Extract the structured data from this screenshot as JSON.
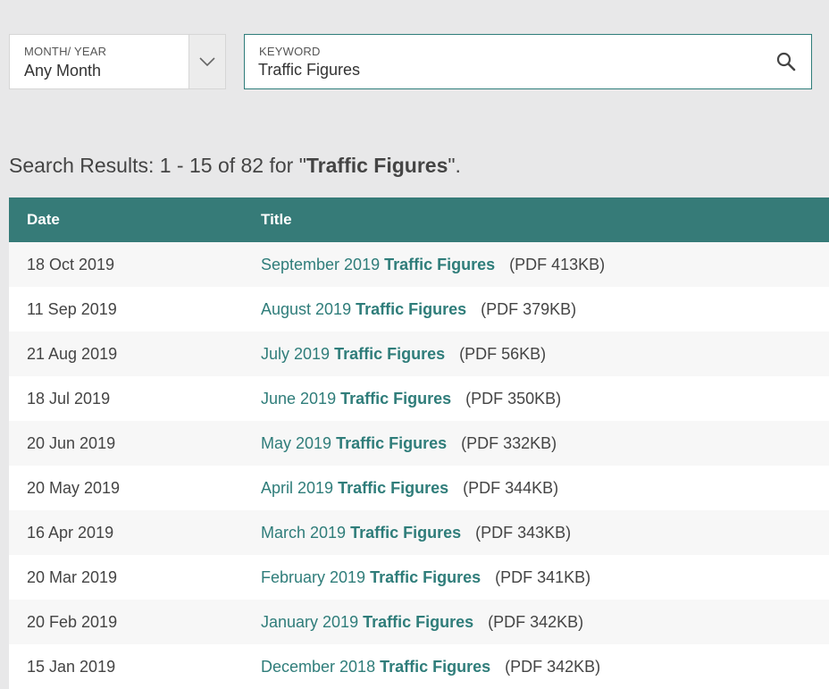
{
  "filters": {
    "month_year": {
      "label": "MONTH/ YEAR",
      "value": "Any Month",
      "icon": "chevron-down-icon"
    },
    "keyword": {
      "label": "KEYWORD",
      "value": "Traffic Figures",
      "icon": "search-icon"
    }
  },
  "results_heading": {
    "prefix": "Search Results: 1 - 15 of 82 for \"",
    "query": "Traffic Figures",
    "suffix": "\"."
  },
  "table": {
    "columns": [
      "Date",
      "Title"
    ],
    "rows": [
      {
        "date": "18 Oct 2019",
        "title_prefix": "September 2019 ",
        "title_em": "Traffic Figures",
        "size": "(PDF 413KB)"
      },
      {
        "date": "11 Sep 2019",
        "title_prefix": "August 2019 ",
        "title_em": "Traffic Figures",
        "size": "(PDF 379KB)"
      },
      {
        "date": "21 Aug 2019",
        "title_prefix": "July 2019 ",
        "title_em": "Traffic Figures",
        "size": "(PDF 56KB)"
      },
      {
        "date": "18 Jul 2019",
        "title_prefix": "June 2019 ",
        "title_em": "Traffic Figures",
        "size": "(PDF 350KB)"
      },
      {
        "date": "20 Jun 2019",
        "title_prefix": "May 2019 ",
        "title_em": "Traffic Figures",
        "size": "(PDF 332KB)"
      },
      {
        "date": "20 May 2019",
        "title_prefix": "April 2019 ",
        "title_em": "Traffic Figures",
        "size": "(PDF 344KB)"
      },
      {
        "date": "16 Apr 2019",
        "title_prefix": "March 2019 ",
        "title_em": "Traffic Figures",
        "size": "(PDF 343KB)"
      },
      {
        "date": "20 Mar 2019",
        "title_prefix": "February 2019 ",
        "title_em": "Traffic Figures",
        "size": "(PDF 341KB)"
      },
      {
        "date": "20 Feb 2019",
        "title_prefix": "January 2019 ",
        "title_em": "Traffic Figures",
        "size": "(PDF 342KB)"
      },
      {
        "date": "15 Jan 2019",
        "title_prefix": "December 2018 ",
        "title_em": "Traffic Figures",
        "size": "(PDF 342KB)"
      }
    ]
  },
  "colors": {
    "accent": "#367b78",
    "link": "#2f7d7a",
    "page_background": "#e8e8e9"
  }
}
